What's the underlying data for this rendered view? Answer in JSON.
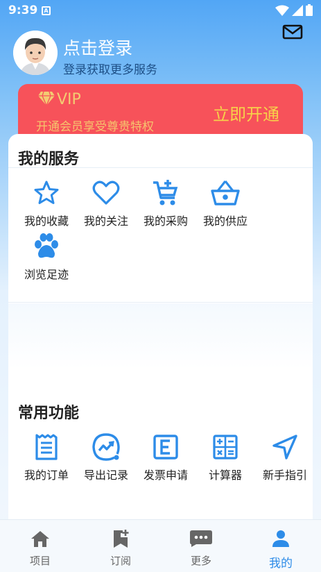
{
  "status": {
    "time": "9:39",
    "notif_icon": "A"
  },
  "header": {
    "login_title": "点击登录",
    "login_subtitle": "登录获取更多服务",
    "mail_icon": "mail-icon"
  },
  "vip": {
    "label": "VIP",
    "description": "开通会员享受尊贵特权",
    "button": "立即开通",
    "colors": {
      "background": "#f7525a",
      "text": "#f6c36d"
    }
  },
  "my_services": {
    "title": "我的服务",
    "items": [
      {
        "label": "我的收藏",
        "icon": "star-icon"
      },
      {
        "label": "我的关注",
        "icon": "heart-icon"
      },
      {
        "label": "我的采购",
        "icon": "cart-add-icon"
      },
      {
        "label": "我的供应",
        "icon": "basket-icon"
      },
      {
        "label": "浏览足迹",
        "icon": "paw-icon"
      }
    ]
  },
  "common_functions": {
    "title": "常用功能",
    "items": [
      {
        "label": "我的订单",
        "icon": "receipt-icon"
      },
      {
        "label": "导出记录",
        "icon": "chart-export-icon"
      },
      {
        "label": "发票申请",
        "icon": "invoice-icon"
      },
      {
        "label": "计算器",
        "icon": "calculator-icon"
      },
      {
        "label": "新手指引",
        "icon": "navigation-icon"
      }
    ]
  },
  "tabs": [
    {
      "label": "项目",
      "icon": "home-icon"
    },
    {
      "label": "订阅",
      "icon": "bookmark-add-icon"
    },
    {
      "label": "更多",
      "icon": "more-chat-icon"
    },
    {
      "label": "我的",
      "icon": "person-icon",
      "active": true
    }
  ],
  "colors": {
    "accent": "#2d8ce8",
    "icon": "#2d8ce8"
  }
}
